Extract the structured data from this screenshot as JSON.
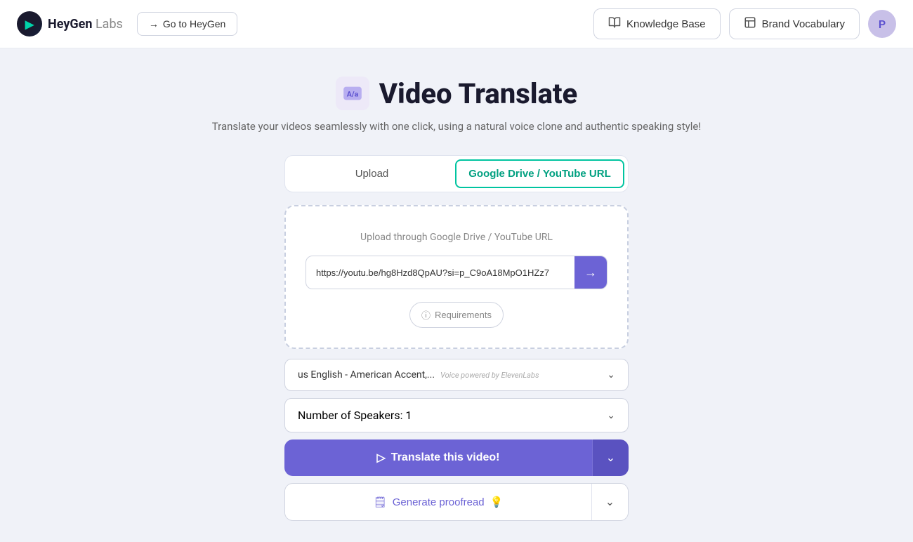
{
  "header": {
    "logo_text": "HeyGen",
    "logo_labs": "Labs",
    "go_heygen_label": "Go to HeyGen",
    "knowledge_base_label": "Knowledge Base",
    "brand_vocabulary_label": "Brand Vocabulary",
    "avatar_initial": "P"
  },
  "page": {
    "title": "Video Translate",
    "subtitle": "Translate your videos seamlessly with one click, using a natural voice clone and authentic speaking style!"
  },
  "tabs": [
    {
      "id": "upload",
      "label": "Upload",
      "active": false
    },
    {
      "id": "google-drive",
      "label": "Google Drive / YouTube URL",
      "active": true
    }
  ],
  "upload_area": {
    "label": "Upload through Google Drive / YouTube URL",
    "url_placeholder": "https://youtu.be/hg8Hzd8QpAU?si=p_C9oA18MpO1HZz7",
    "url_value": "https://youtu.be/hg8Hzd8QpAU?si=p_C9oA18MpO1HZz7",
    "requirements_label": "Requirements"
  },
  "voice_dropdown": {
    "value": "us English - American Accent,...",
    "powered_by": "Voice powered by ElevenLabs"
  },
  "speakers_dropdown": {
    "label": "Number of Speakers: 1"
  },
  "translate_button": {
    "label": "Translate this video!"
  },
  "proofread_button": {
    "label": "Generate proofread",
    "emoji": "💡"
  },
  "icons": {
    "arrow_right": "→",
    "chevron_down": "⌄",
    "info": "ⓘ",
    "translate_icon": "▷",
    "proofread_icon": "🗒"
  }
}
